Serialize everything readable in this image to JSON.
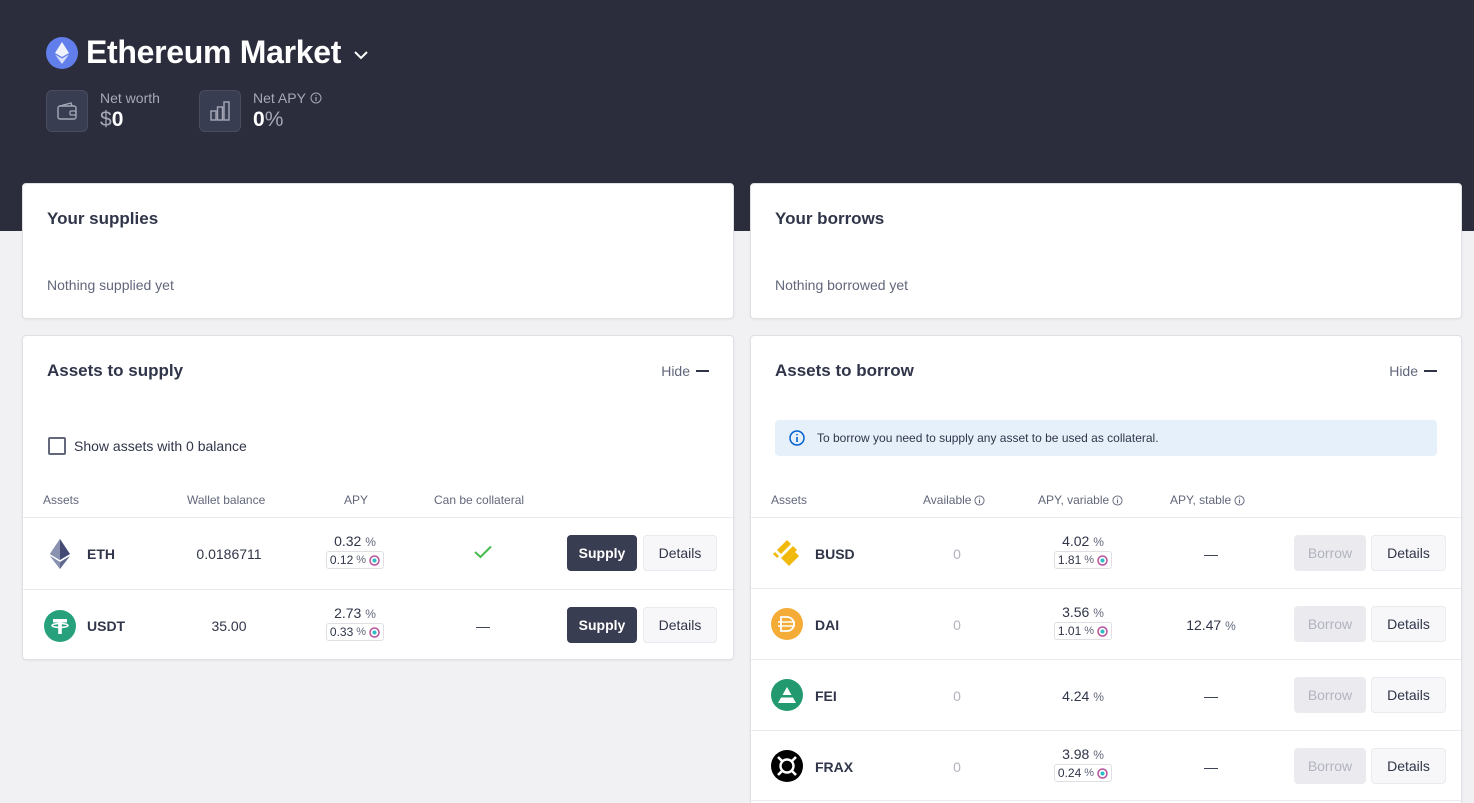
{
  "header": {
    "market_title": "Ethereum Market",
    "net_worth_label": "Net worth",
    "net_worth_currency": "$",
    "net_worth_value": "0",
    "net_apy_label": "Net APY",
    "net_apy_value": "0",
    "net_apy_unit": "%"
  },
  "supplies": {
    "title": "Your supplies",
    "empty_text": "Nothing supplied yet"
  },
  "borrows": {
    "title": "Your borrows",
    "empty_text": "Nothing borrowed yet"
  },
  "assets_to_supply": {
    "title": "Assets to supply",
    "hide_label": "Hide",
    "checkbox_label": "Show assets with 0 balance",
    "columns": [
      "Assets",
      "Wallet balance",
      "APY",
      "Can be collateral"
    ],
    "rows": [
      {
        "symbol": "ETH",
        "balance": "0.0186711",
        "apy": "0.32",
        "apy_incentive": "0.12",
        "collateral": "✓",
        "supply_label": "Supply",
        "details_label": "Details"
      },
      {
        "symbol": "USDT",
        "balance": "35.00",
        "apy": "2.73",
        "apy_incentive": "0.33",
        "collateral": "—",
        "supply_label": "Supply",
        "details_label": "Details"
      }
    ]
  },
  "assets_to_borrow": {
    "title": "Assets to borrow",
    "hide_label": "Hide",
    "info_text": "To borrow you need to supply any asset to be used as collateral.",
    "columns": [
      "Assets",
      "Available",
      "APY, variable",
      "APY, stable"
    ],
    "rows": [
      {
        "symbol": "BUSD",
        "available": "0",
        "apy_variable": "4.02",
        "apy_incentive": "1.81",
        "apy_stable": "—",
        "borrow_label": "Borrow",
        "details_label": "Details"
      },
      {
        "symbol": "DAI",
        "available": "0",
        "apy_variable": "3.56",
        "apy_incentive": "1.01",
        "apy_stable": "12.47",
        "borrow_label": "Borrow",
        "details_label": "Details"
      },
      {
        "symbol": "FEI",
        "available": "0",
        "apy_variable": "4.24",
        "apy_incentive": "",
        "apy_stable": "—",
        "borrow_label": "Borrow",
        "details_label": "Details"
      },
      {
        "symbol": "FRAX",
        "available": "0",
        "apy_variable": "3.98",
        "apy_incentive": "0.24",
        "apy_stable": "—",
        "borrow_label": "Borrow",
        "details_label": "Details"
      }
    ]
  },
  "percent_unit": "%",
  "colors": {
    "header_bg": "#2b2d3c",
    "eth": "#627eea",
    "usdt": "#26a17b",
    "busd": "#f0b90b",
    "dai": "#f5ac37",
    "fei": "#22996e",
    "frax": "#000000",
    "check": "#46bc4b"
  }
}
